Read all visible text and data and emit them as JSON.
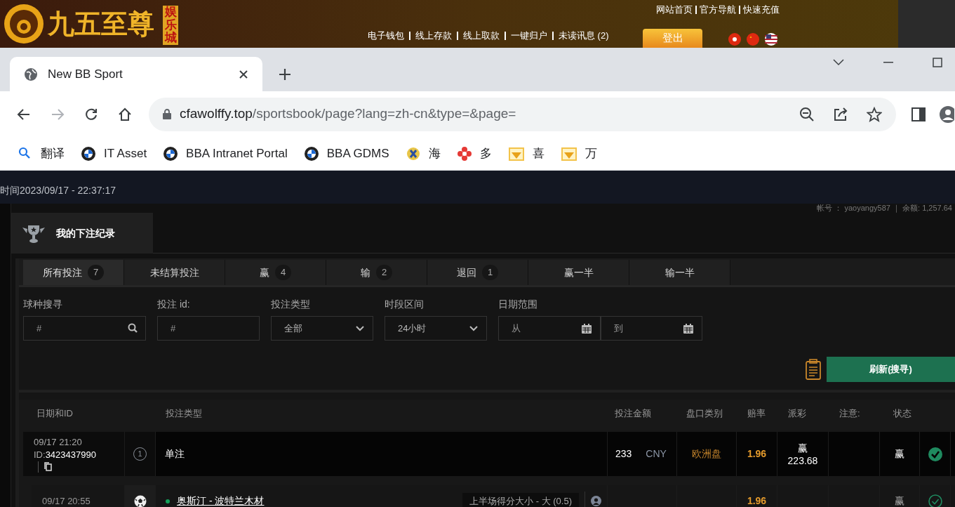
{
  "site_header": {
    "logo_text": "九五至尊",
    "logo_badge": "娱乐城",
    "top_links": [
      "网站首页",
      "官方导航",
      "快速充值"
    ],
    "nav_links": [
      "电子钱包",
      "线上存款",
      "线上取款",
      "一键归户",
      "未读讯息 (2)"
    ],
    "logout_button": "登出"
  },
  "browser": {
    "tab_title": "New BB Sport",
    "url_domain": "cfawolffy.top",
    "url_path": "/sportsbook/page?lang=zh-cn&type=&page=",
    "bookmarks": [
      {
        "label": "翻译",
        "kind": "search"
      },
      {
        "label": "IT Asset",
        "kind": "roundel"
      },
      {
        "label": "BBA Intranet Portal",
        "kind": "roundel"
      },
      {
        "label": "BBA GDMS",
        "kind": "roundel"
      },
      {
        "label": "海",
        "kind": "badge"
      },
      {
        "label": "多",
        "kind": "flower"
      },
      {
        "label": "喜",
        "kind": "folder"
      },
      {
        "label": "万",
        "kind": "folder"
      }
    ]
  },
  "page": {
    "server_time": "时间2023/09/17 - 22:37:17",
    "account": "帐号 ： yaoyangy587 ｜ 余额: 1,257.64",
    "panel_title": "我的下注纪录",
    "tabs": [
      {
        "label": "所有投注",
        "count": "7",
        "selected": true
      },
      {
        "label": "未结算投注",
        "selected": false
      },
      {
        "label": "赢",
        "count": "4",
        "selected": false
      },
      {
        "label": "输",
        "count": "2",
        "selected": false
      },
      {
        "label": "退回",
        "count": "1",
        "selected": false
      },
      {
        "label": "赢一半",
        "selected": false
      },
      {
        "label": "输一半",
        "selected": false
      }
    ],
    "filters": [
      {
        "label": "球种搜寻",
        "kind": "search",
        "placeholder": "#"
      },
      {
        "label": "投注 id:",
        "kind": "text",
        "placeholder": "#"
      },
      {
        "label": "投注类型",
        "kind": "select",
        "value": "全部"
      },
      {
        "label": "时段区间",
        "kind": "select",
        "value": "24小时"
      },
      {
        "label": "日期范围",
        "kind": "daterange",
        "from": "从",
        "to": "到"
      }
    ],
    "refresh_button": "刷新(搜寻)",
    "columns": [
      "日期和ID",
      "投注类型",
      "投注金额",
      "盘口类别",
      "赔率",
      "派彩",
      "注意:",
      "状态"
    ],
    "bet": {
      "datetime": "09/17 21:20",
      "id_label": "ID:",
      "id": "3423437990",
      "legs_count": "1",
      "type": "单注",
      "amount": "233",
      "currency": "CNY",
      "market": "欧洲盘",
      "odds": "1.96",
      "payout_label": "赢",
      "payout": "223.68",
      "status": "赢"
    },
    "leg": {
      "time": "09/17 20:55",
      "match": "奥斯汀 - 波特兰木材",
      "selection": "上半场得分大小 - 大 (0.5)",
      "odds": "1.96",
      "status": "赢"
    }
  }
}
